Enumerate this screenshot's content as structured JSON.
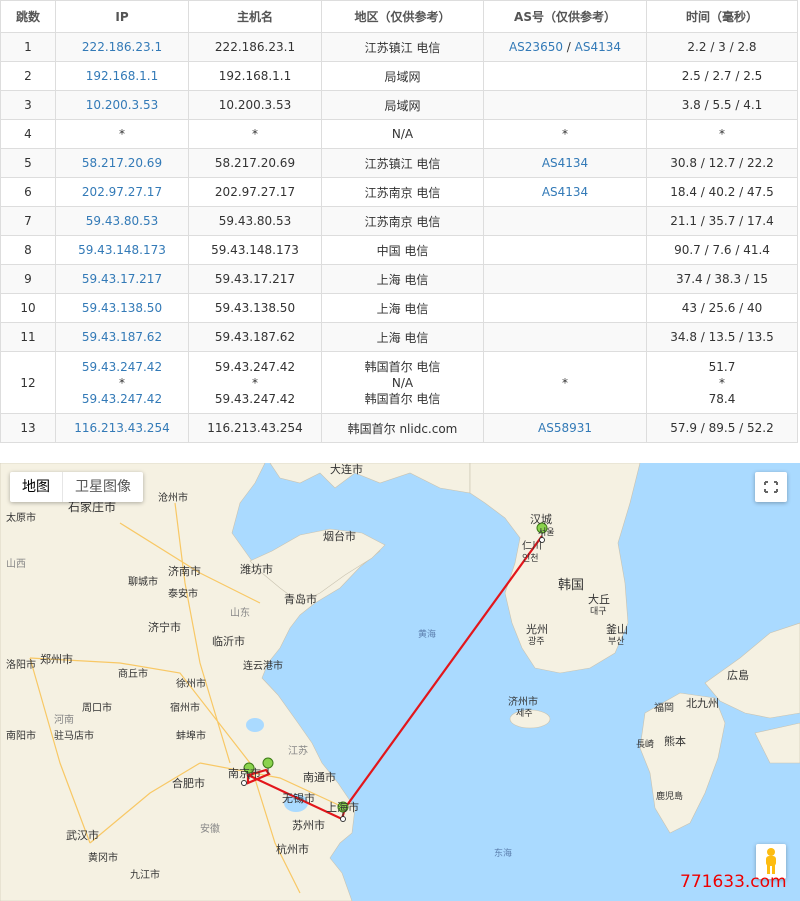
{
  "table": {
    "headers": [
      "跳数",
      "IP",
      "主机名",
      "地区（仅供参考）",
      "AS号（仅供参考）",
      "时间（毫秒）"
    ],
    "rows": [
      {
        "hop": "1",
        "ip": "222.186.23.1",
        "host": "222.186.23.1",
        "region": "江苏镇江 电信",
        "as1": "AS23650",
        "as_sep": " / ",
        "as2": "AS4134",
        "time": "2.2 / 3 / 2.8"
      },
      {
        "hop": "2",
        "ip": "192.168.1.1",
        "host": "192.168.1.1",
        "region": "局域网",
        "as1": "",
        "as_sep": "",
        "as2": "",
        "time": "2.5 / 2.7 / 2.5"
      },
      {
        "hop": "3",
        "ip": "10.200.3.53",
        "host": "10.200.3.53",
        "region": "局域网",
        "as1": "",
        "as_sep": "",
        "as2": "",
        "time": "3.8 / 5.5 / 4.1"
      },
      {
        "hop": "4",
        "ip": "*",
        "host": "*",
        "region": "N/A",
        "as1": "*",
        "as_sep": "",
        "as2": "",
        "time": "*"
      },
      {
        "hop": "5",
        "ip": "58.217.20.69",
        "host": "58.217.20.69",
        "region": "江苏镇江 电信",
        "as1": "AS4134",
        "as_sep": "",
        "as2": "",
        "time": "30.8 / 12.7 / 22.2"
      },
      {
        "hop": "6",
        "ip": "202.97.27.17",
        "host": "202.97.27.17",
        "region": "江苏南京 电信",
        "as1": "AS4134",
        "as_sep": "",
        "as2": "",
        "time": "18.4 / 40.2 / 47.5"
      },
      {
        "hop": "7",
        "ip": "59.43.80.53",
        "host": "59.43.80.53",
        "region": "江苏南京 电信",
        "as1": "",
        "as_sep": "",
        "as2": "",
        "time": "21.1 / 35.7 / 17.4"
      },
      {
        "hop": "8",
        "ip": "59.43.148.173",
        "host": "59.43.148.173",
        "region": "中国 电信",
        "as1": "",
        "as_sep": "",
        "as2": "",
        "time": "90.7 / 7.6 / 41.4"
      },
      {
        "hop": "9",
        "ip": "59.43.17.217",
        "host": "59.43.17.217",
        "region": "上海 电信",
        "as1": "",
        "as_sep": "",
        "as2": "",
        "time": "37.4 / 38.3 / 15"
      },
      {
        "hop": "10",
        "ip": "59.43.138.50",
        "host": "59.43.138.50",
        "region": "上海 电信",
        "as1": "",
        "as_sep": "",
        "as2": "",
        "time": "43 / 25.6 / 40"
      },
      {
        "hop": "11",
        "ip": "59.43.187.62",
        "host": "59.43.187.62",
        "region": "上海 电信",
        "as1": "",
        "as_sep": "",
        "as2": "",
        "time": "34.8 / 13.5 / 13.5"
      }
    ],
    "row12": {
      "hop": "12",
      "ips": [
        "59.43.247.42",
        "*",
        "59.43.247.42"
      ],
      "hosts": [
        "59.43.247.42",
        "*",
        "59.43.247.42"
      ],
      "regions": [
        "韩国首尔 电信",
        "N/A",
        "韩国首尔 电信"
      ],
      "as": "*",
      "times": [
        "51.7",
        "*",
        "78.4"
      ]
    },
    "row13": {
      "hop": "13",
      "ip": "116.213.43.254",
      "host": "116.213.43.254",
      "region": "韩国首尔 nlidc.com",
      "as1": "AS58931",
      "time": "57.9 / 89.5 / 52.2"
    }
  },
  "map": {
    "type_map_label": "地图",
    "type_satellite_label": "卫星图像",
    "route_color": "#e3161b",
    "pin_color": "#8ad24d",
    "land_color": "#f5f1e2",
    "sea_color": "#aadaff",
    "labels": {
      "dalian": "大连市",
      "cangzhou": "沧州市",
      "shijiazhuang": "石家庄市",
      "taiyuan": "太原市",
      "shan": "山西",
      "yantai": "烟台市",
      "weifang": "潍坊市",
      "jinan": "济南市",
      "liaocheng": "聊城市",
      "taian": "泰安市",
      "qingdao": "青岛市",
      "shandong": "山东",
      "jining": "济宁市",
      "linyi": "临沂市",
      "zhengzhou": "郑州市",
      "shangqiu": "商丘市",
      "xuzhou": "徐州市",
      "lianyungang": "连云港市",
      "luoyang": "洛阳市",
      "zhoukou": "周口市",
      "suzhou_ah": "宿州市",
      "henan": "河南",
      "zhumadian": "驻马店市",
      "nanyang": "南阳市",
      "bengbu": "蚌埠市",
      "jiangsu": "江苏",
      "nanjing": "南京市",
      "nantong": "南通市",
      "hefei": "合肥市",
      "wuxi": "无锡市",
      "shanghai": "上海市",
      "suzhou": "苏州市",
      "anhui": "安徽",
      "wuhan": "武汉市",
      "huanggang": "黄冈市",
      "hangzhou": "杭州市",
      "jiujiang": "九江市",
      "yellow_sea": "黄海",
      "east_sea": "东海",
      "seoul": "汉城",
      "seoul_ko": "서울",
      "incheon": "仁川",
      "incheon_ko": "인천",
      "korea": "韩国",
      "daegu": "大丘",
      "daegu_ko": "대구",
      "gwangju": "光州",
      "gwangju_ko": "광주",
      "busan": "釜山",
      "busan_ko": "부산",
      "jeju": "济州市",
      "jeju_ko": "제주",
      "hiroshima": "広島",
      "fukuoka": "福岡",
      "kitakyushu": "北九州",
      "nagasaki": "長崎",
      "kumamoto": "熊本",
      "kagoshima": "鹿児島"
    }
  },
  "watermark": "771633.com"
}
